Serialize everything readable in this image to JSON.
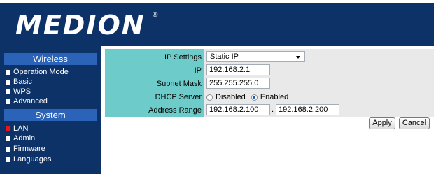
{
  "brand": {
    "logo_text": "MEDION",
    "trademark": "®"
  },
  "sidebar": {
    "sections": [
      {
        "title": "Wireless",
        "items": [
          {
            "label": "Operation Mode",
            "active": false
          },
          {
            "label": "Basic",
            "active": false
          },
          {
            "label": "WPS",
            "active": false
          },
          {
            "label": "Advanced",
            "active": false
          }
        ]
      },
      {
        "title": "System",
        "items": [
          {
            "label": "LAN",
            "active": true
          },
          {
            "label": "Admin",
            "active": false
          },
          {
            "label": "Firmware",
            "active": false
          },
          {
            "label": "Languages",
            "active": false
          }
        ]
      }
    ]
  },
  "form": {
    "ip_settings": {
      "label": "IP Settings",
      "value": "Static IP"
    },
    "ip": {
      "label": "IP",
      "value": "192.168.2.1"
    },
    "subnet_mask": {
      "label": "Subnet Mask",
      "value": "255.255.255.0"
    },
    "dhcp_server": {
      "label": "DHCP Server",
      "options": [
        "Disabled",
        "Enabled"
      ],
      "selected": "Enabled"
    },
    "address_range": {
      "label": "Address Range",
      "start": "192.168.2.100",
      "separator": ".",
      "end": "192.168.2.200"
    }
  },
  "buttons": {
    "apply": "Apply",
    "cancel": "Cancel"
  },
  "colors": {
    "navy": "#0c3268",
    "section_blue": "#2a63b8",
    "label_teal": "#6dcbc9",
    "active_bullet": "#e8161b"
  }
}
